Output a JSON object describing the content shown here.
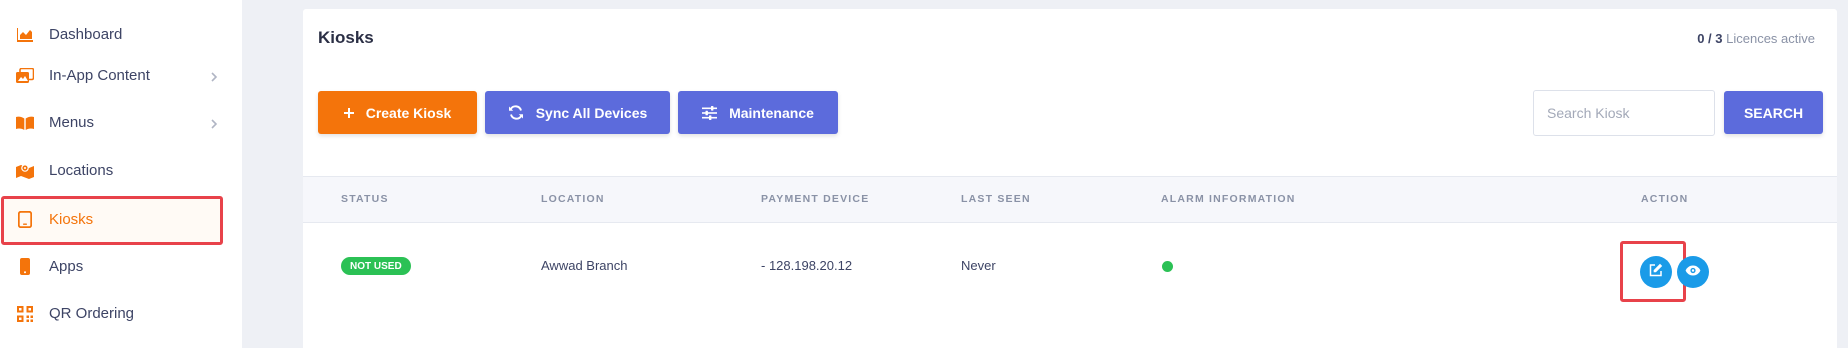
{
  "sidebar": {
    "items": [
      {
        "label": "Dashboard",
        "icon": "chart-icon",
        "has_submenu": false
      },
      {
        "label": "In-App Content",
        "icon": "images-icon",
        "has_submenu": true
      },
      {
        "label": "Menus",
        "icon": "book-icon",
        "has_submenu": true
      },
      {
        "label": "Locations",
        "icon": "map-icon",
        "has_submenu": false
      },
      {
        "label": "Kiosks",
        "icon": "tablet-icon",
        "has_submenu": false,
        "active": true
      },
      {
        "label": "Apps",
        "icon": "mobile-icon",
        "has_submenu": false
      },
      {
        "label": "QR Ordering",
        "icon": "qrcode-icon",
        "has_submenu": false
      }
    ]
  },
  "page": {
    "title": "Kiosks",
    "licences_count": "0 / 3",
    "licences_label": "Licences active"
  },
  "toolbar": {
    "create_label": "Create Kiosk",
    "sync_label": "Sync All Devices",
    "maintenance_label": "Maintenance",
    "search_placeholder": "Search Kiosk",
    "search_button_label": "SEARCH"
  },
  "table": {
    "columns": [
      "STATUS",
      "LOCATION",
      "PAYMENT DEVICE",
      "LAST SEEN",
      "ALARM INFORMATION",
      "ACTION"
    ],
    "rows": [
      {
        "status": "NOT USED",
        "location": "Awwad Branch",
        "payment_device": "- 128.198.20.12",
        "last_seen": "Never",
        "alarm_status": "ok"
      }
    ]
  },
  "colors": {
    "accent_orange": "#f4740b",
    "accent_blue": "#5c6bdc",
    "status_green": "#2bc155",
    "action_blue": "#1a9be8",
    "highlight_red": "#e8424a"
  }
}
